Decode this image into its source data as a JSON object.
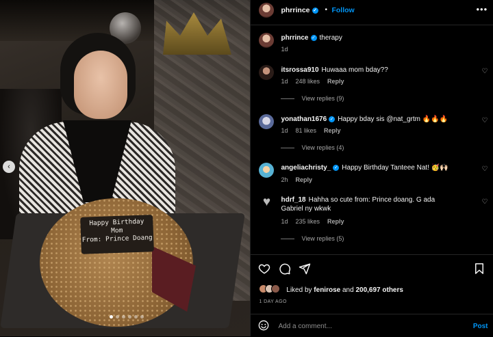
{
  "post": {
    "author": "phrrince",
    "follow_label": "Follow",
    "separator": "•",
    "more_icon": "•••",
    "caption_user": "phrrince",
    "caption_text": "therapy",
    "caption_time": "1d"
  },
  "photo": {
    "plaque_line1": "Happy Birthday",
    "plaque_line2": "Mom",
    "plaque_line3": "From: Prince Doang",
    "prev_icon": "‹"
  },
  "comments": [
    {
      "user": "itsrossa910",
      "verified": false,
      "text": "Huwaaa mom bday??",
      "time": "1d",
      "likes": "248 likes",
      "reply": "Reply",
      "view_replies": "View replies (9)"
    },
    {
      "user": "yonathan1676",
      "verified": true,
      "text": "Happy bday sis @nat_grtm 🔥🔥🔥",
      "time": "1d",
      "likes": "81 likes",
      "reply": "Reply",
      "view_replies": "View replies (4)"
    },
    {
      "user": "angeliachristy_",
      "verified": true,
      "text": "Happy Birthday Tanteee Nat! 🥳🙌🏻",
      "time": "2h",
      "likes": "",
      "reply": "Reply",
      "view_replies": ""
    },
    {
      "user": "hdrf_18",
      "verified": false,
      "text": "Hahha so cute from: Prince doang. G ada Gabriel ny wkwk",
      "time": "1d",
      "likes": "235 likes",
      "reply": "Reply",
      "view_replies": "View replies (5)"
    }
  ],
  "actions": {
    "like_icon": "heart-icon",
    "comment_icon": "comment-icon",
    "share_icon": "share-icon",
    "save_icon": "bookmark-icon"
  },
  "likes": {
    "prefix": "Liked by",
    "user": "fenirose",
    "mid": "and",
    "count": "200,697 others"
  },
  "time_ago": "1 DAY AGO",
  "add_comment": {
    "placeholder": "Add a comment...",
    "post_label": "Post"
  },
  "colors": {
    "accent": "#0095f6",
    "background": "#000000"
  }
}
